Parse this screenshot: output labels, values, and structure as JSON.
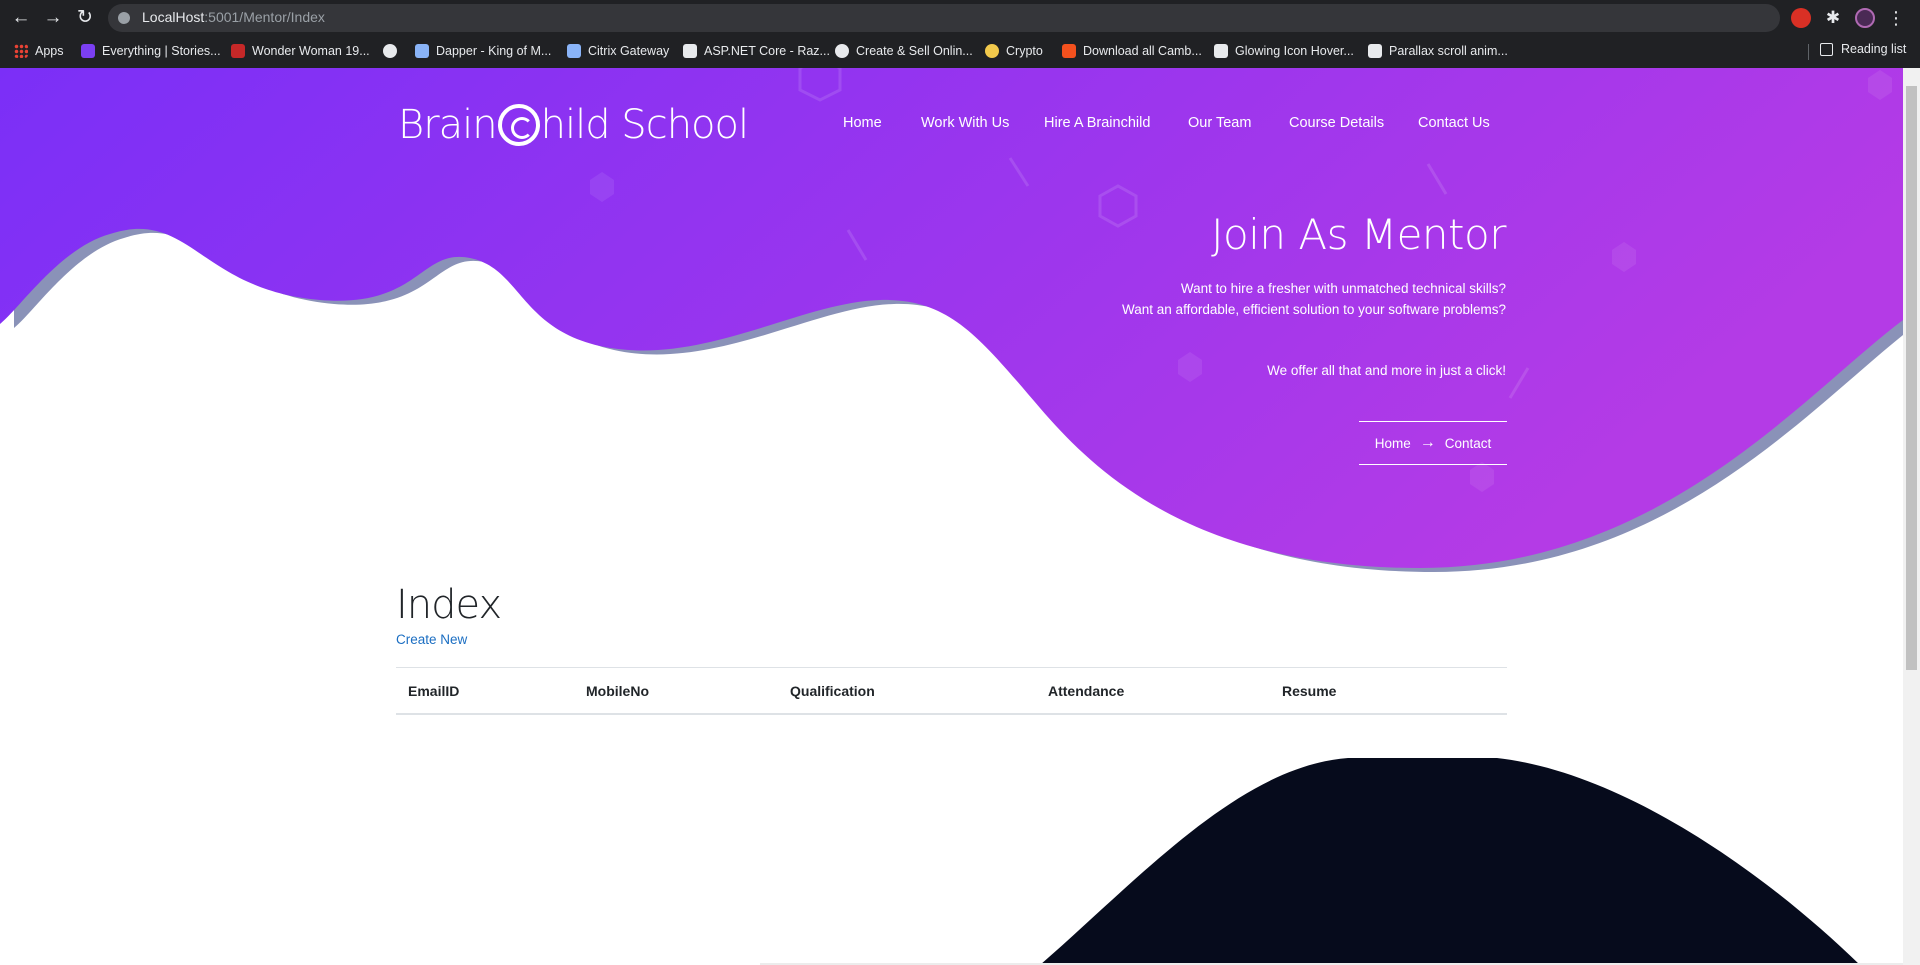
{
  "browser": {
    "url_host": "LocalHost",
    "url_path": ":5001/Mentor/Index",
    "bookmarks": [
      {
        "label": "Apps",
        "color": "#ea4335"
      },
      {
        "label": "Everything | Stories...",
        "color": "#7b3ff2"
      },
      {
        "label": "Wonder Woman 19...",
        "color": "#c62828"
      },
      {
        "label": "",
        "color": "#e8eaed"
      },
      {
        "label": "Dapper - King of M...",
        "color": "#8ab4f8"
      },
      {
        "label": "Citrix Gateway",
        "color": "#8ab4f8"
      },
      {
        "label": "ASP.NET Core - Raz...",
        "color": "#e8eaed"
      },
      {
        "label": "Create & Sell Onlin...",
        "color": "#e8eaed"
      },
      {
        "label": "Crypto",
        "color": "#f2c94c"
      },
      {
        "label": "Download all Camb...",
        "color": "#f4511e"
      },
      {
        "label": "Glowing Icon Hover...",
        "color": "#e8eaed"
      },
      {
        "label": "Parallax scroll anim...",
        "color": "#e8eaed"
      }
    ],
    "reading_list": "Reading list"
  },
  "site": {
    "logo_left": "Brain",
    "logo_right": "hild School",
    "nav": [
      "Home",
      "Work With Us",
      "Hire A Brainchild",
      "Our Team",
      "Course Details",
      "Contact Us"
    ]
  },
  "hero": {
    "title": "Join As Mentor",
    "line1": "Want to hire a fresher with unmatched technical skills?",
    "line2": "Want an affordable, efficient solution to your software problems?",
    "line3": "We offer all that and more in just a click!",
    "crumb_home": "Home",
    "crumb_arrow": "→",
    "crumb_contact": "Contact"
  },
  "content": {
    "title": "Index",
    "create_link": "Create New",
    "columns": [
      "EmailID",
      "MobileNo",
      "Qualification",
      "Attendance",
      "Resume"
    ]
  },
  "colors": {
    "hero_start": "#7b2ff7",
    "hero_end": "#b43be6",
    "wave_shadow": "#8a92b8",
    "footer_wave": "#060b1c",
    "link": "#1b6ec2"
  }
}
